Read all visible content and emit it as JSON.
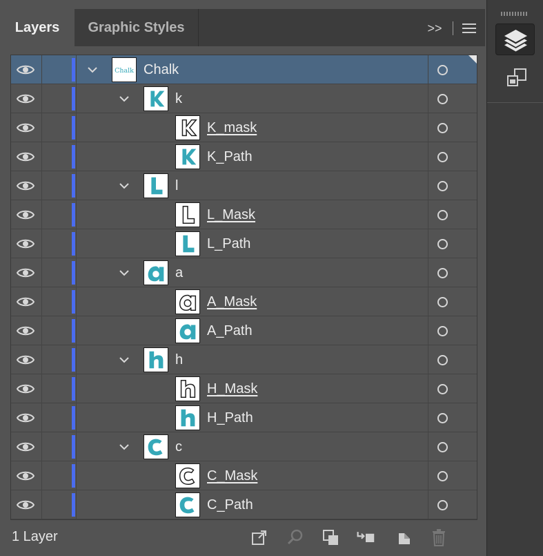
{
  "tabs": {
    "layers": "Layers",
    "graphic_styles": "Graphic Styles"
  },
  "tab_more": ">>",
  "rows": [
    {
      "label": "Chalk",
      "level": 0,
      "expandable": true,
      "clip": false,
      "thumb": "chalk",
      "selected": true
    },
    {
      "label": "k",
      "level": 1,
      "expandable": true,
      "clip": false,
      "thumb": "k"
    },
    {
      "label": "K_mask",
      "level": 2,
      "expandable": false,
      "clip": true,
      "thumb": "k-outline"
    },
    {
      "label": "K_Path",
      "level": 2,
      "expandable": false,
      "clip": false,
      "thumb": "k"
    },
    {
      "label": "l",
      "level": 1,
      "expandable": true,
      "clip": false,
      "thumb": "l"
    },
    {
      "label": "L_Mask",
      "level": 2,
      "expandable": false,
      "clip": true,
      "thumb": "l-outline"
    },
    {
      "label": "L_Path",
      "level": 2,
      "expandable": false,
      "clip": false,
      "thumb": "l"
    },
    {
      "label": "a",
      "level": 1,
      "expandable": true,
      "clip": false,
      "thumb": "a"
    },
    {
      "label": "A_Mask",
      "level": 2,
      "expandable": false,
      "clip": true,
      "thumb": "a-outline"
    },
    {
      "label": "A_Path",
      "level": 2,
      "expandable": false,
      "clip": false,
      "thumb": "a"
    },
    {
      "label": "h",
      "level": 1,
      "expandable": true,
      "clip": false,
      "thumb": "h"
    },
    {
      "label": "H_Mask",
      "level": 2,
      "expandable": false,
      "clip": true,
      "thumb": "h-outline"
    },
    {
      "label": "H_Path",
      "level": 2,
      "expandable": false,
      "clip": false,
      "thumb": "h"
    },
    {
      "label": "c",
      "level": 1,
      "expandable": true,
      "clip": false,
      "thumb": "c"
    },
    {
      "label": "C_Mask",
      "level": 2,
      "expandable": false,
      "clip": true,
      "thumb": "c-outline"
    },
    {
      "label": "C_Path",
      "level": 2,
      "expandable": false,
      "clip": false,
      "thumb": "c"
    }
  ],
  "thumb_chalk_text": "Chalk",
  "footer": {
    "layer_count": "1 Layer"
  },
  "colors": {
    "layer_color": "#4a6cf0",
    "thumb_teal": "#35a8b8",
    "selected_row": "#4b6783",
    "panel_bg": "#535353",
    "tab_bar_bg": "#3c3c3c"
  },
  "icons": {
    "visibility": "eye-icon",
    "expand": "chevron-down-icon",
    "target": "target-circle-icon",
    "panel_menu": "hamburger-menu-icon",
    "export": "export-icon",
    "locate": "search-icon",
    "clipping_mask": "clipping-mask-icon",
    "sublayer": "new-sublayer-icon",
    "new_layer": "new-layer-icon",
    "delete": "trash-icon",
    "dock_layers": "layers-stack-icon",
    "dock_artboards": "artboards-icon"
  }
}
